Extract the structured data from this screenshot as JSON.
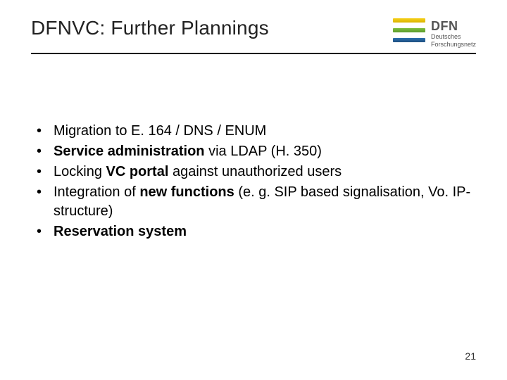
{
  "header": {
    "title": "DFNVC: Further Plannings",
    "logo": {
      "acronym": "DFN",
      "subtitle_line1": "Deutsches",
      "subtitle_line2": "Forschungsnetz"
    }
  },
  "bullets": [
    {
      "runs": [
        {
          "t": "Migration to E. 164 / DNS / ENUM",
          "b": false
        }
      ]
    },
    {
      "runs": [
        {
          "t": "Service administration",
          "b": true
        },
        {
          "t": " via LDAP (H. 350)",
          "b": false
        }
      ]
    },
    {
      "runs": [
        {
          "t": "Locking ",
          "b": false
        },
        {
          "t": "VC portal",
          "b": true
        },
        {
          "t": " against unauthorized users",
          "b": false
        }
      ]
    },
    {
      "runs": [
        {
          "t": "Integration of ",
          "b": false
        },
        {
          "t": "new functions",
          "b": true
        },
        {
          "t": " (e. g. SIP based signalisation, Vo. IP-structure)",
          "b": false
        }
      ]
    },
    {
      "runs": [
        {
          "t": "Reservation system",
          "b": true
        }
      ]
    }
  ],
  "page_number": "21"
}
